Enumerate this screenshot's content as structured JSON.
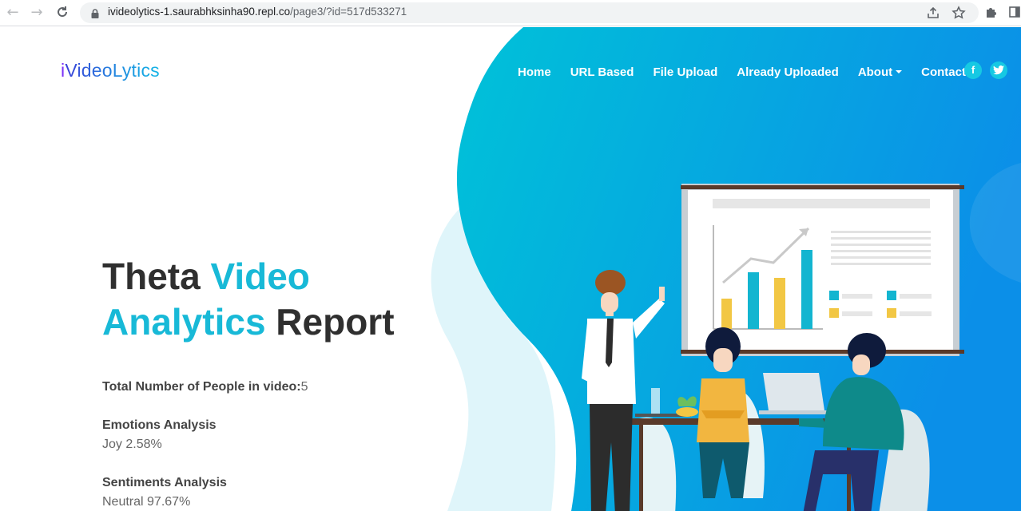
{
  "browser": {
    "url_host": "ivideolytics-1.saurabhksinha90.repl.co",
    "url_path": "/page3/?id=517d533271"
  },
  "brand": {
    "first": "i",
    "rest": "VideoLytics"
  },
  "nav": {
    "items": [
      {
        "label": "Home"
      },
      {
        "label": "URL Based"
      },
      {
        "label": "File Upload"
      },
      {
        "label": "Already Uploaded"
      },
      {
        "label": "About"
      },
      {
        "label": "Contact"
      }
    ],
    "social": {
      "facebook": "f",
      "twitter": "t"
    }
  },
  "hero": {
    "title_part1": "Theta ",
    "title_hl1": "Video",
    "title_hl2": "Analytics",
    "title_part2": " Report"
  },
  "report": {
    "people_label": "Total Number of People in video:",
    "people_value": "5",
    "emotions_label": "Emotions Analysis",
    "emotions_value": "Joy 2.58%",
    "sentiments_label": "Sentiments Analysis",
    "sentiments_value": "Neutral 97.67%"
  },
  "colors": {
    "accent": "#18b9d7",
    "hero_gradient_start": "#00c2d8",
    "hero_gradient_end": "#0b8fe8"
  }
}
